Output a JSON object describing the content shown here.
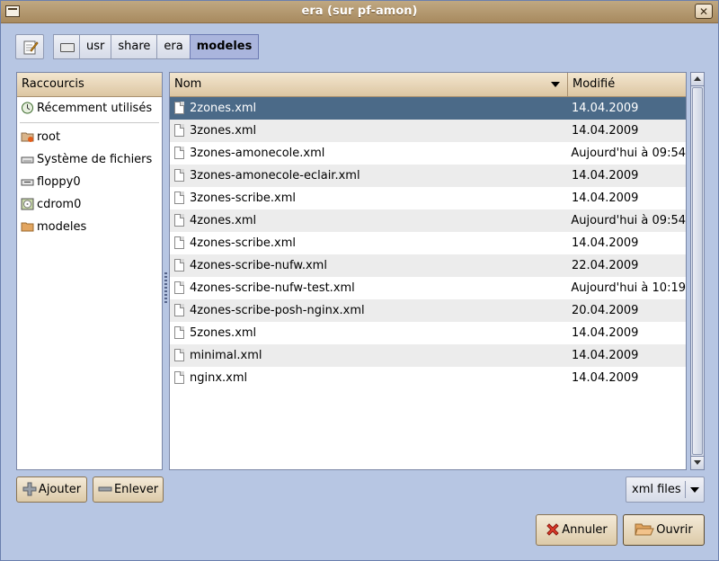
{
  "window": {
    "title": "era (sur pf-amon)"
  },
  "pathbar": {
    "segments": [
      "usr",
      "share",
      "era",
      "modeles"
    ]
  },
  "shortcuts": {
    "header": "Raccourcis",
    "recent": "Récemment utilisés",
    "places": [
      "root",
      "Système de fichiers",
      "floppy0",
      "cdrom0",
      "modeles"
    ]
  },
  "files": {
    "col_name": "Nom",
    "col_modified": "Modifié",
    "rows": [
      {
        "name": "2zones.xml",
        "modified": "14.04.2009"
      },
      {
        "name": "3zones.xml",
        "modified": "14.04.2009"
      },
      {
        "name": "3zones-amonecole.xml",
        "modified": "Aujourd'hui à 09:54"
      },
      {
        "name": "3zones-amonecole-eclair.xml",
        "modified": "14.04.2009"
      },
      {
        "name": "3zones-scribe.xml",
        "modified": "14.04.2009"
      },
      {
        "name": "4zones.xml",
        "modified": "Aujourd'hui à 09:54"
      },
      {
        "name": "4zones-scribe.xml",
        "modified": "14.04.2009"
      },
      {
        "name": "4zones-scribe-nufw.xml",
        "modified": "22.04.2009"
      },
      {
        "name": "4zones-scribe-nufw-test.xml",
        "modified": "Aujourd'hui à 10:19"
      },
      {
        "name": "4zones-scribe-posh-nginx.xml",
        "modified": "20.04.2009"
      },
      {
        "name": "5zones.xml",
        "modified": "14.04.2009"
      },
      {
        "name": "minimal.xml",
        "modified": "14.04.2009"
      },
      {
        "name": "nginx.xml",
        "modified": "14.04.2009"
      }
    ]
  },
  "buttons": {
    "add": "Ajouter",
    "remove": "Enlever",
    "cancel": "Annuler",
    "open": "Ouvrir"
  },
  "filter": {
    "selected": "xml files"
  },
  "colors": {
    "selection": "#4b6a88",
    "background": "#b7c6e3",
    "header": "#dcc6a2"
  }
}
